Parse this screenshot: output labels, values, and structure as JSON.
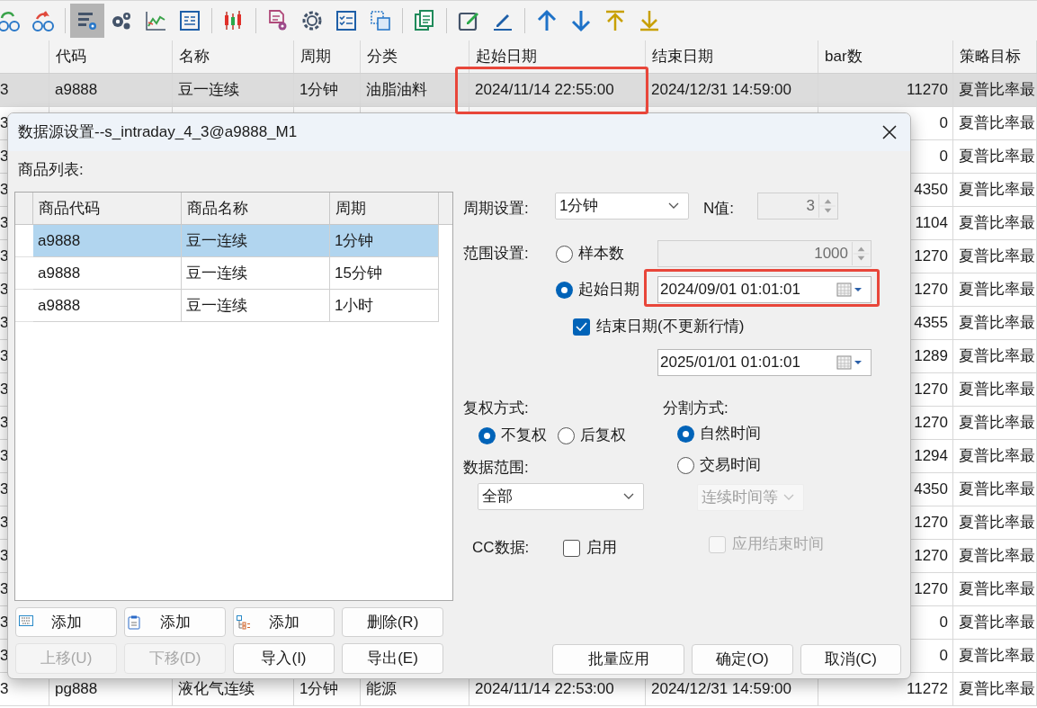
{
  "toolbar": [
    [
      {
        "kind": "glasses-cycle",
        "selected": false
      },
      {
        "kind": "glasses-arrow",
        "selected": false
      }
    ],
    [
      {
        "kind": "list-gear",
        "selected": true
      },
      {
        "kind": "gears",
        "selected": false
      },
      {
        "kind": "line-chart",
        "selected": false
      },
      {
        "kind": "formula",
        "selected": false
      }
    ],
    [
      {
        "kind": "candles",
        "selected": false
      }
    ],
    [
      {
        "kind": "doc-gear",
        "selected": false
      },
      {
        "kind": "gear",
        "selected": false
      },
      {
        "kind": "checklist",
        "selected": false
      },
      {
        "kind": "copy",
        "selected": false
      }
    ],
    [
      {
        "kind": "pages",
        "selected": false
      }
    ],
    [
      {
        "kind": "edit",
        "selected": false
      },
      {
        "kind": "pen",
        "selected": false
      }
    ],
    [
      {
        "kind": "up",
        "selected": false
      },
      {
        "kind": "down",
        "selected": false
      },
      {
        "kind": "top",
        "selected": false
      },
      {
        "kind": "bottom",
        "selected": false
      }
    ]
  ],
  "table": {
    "columns": [
      "代码",
      "名称",
      "周期",
      "分类",
      "起始日期",
      "结束日期",
      "bar数",
      "策略目标"
    ],
    "rows": [
      {
        "column_1": "3",
        "code": "a9888",
        "name": "豆一连续",
        "period": "1分钟",
        "category": "油脂油料",
        "start": "2024/11/14 22:55:00",
        "end": "2024/12/31 14:59:00",
        "bars": "11270",
        "target": "夏普比率最",
        "selected": true
      },
      {
        "column_1": "3",
        "bars": "0",
        "target": "夏普比率最",
        "selected": false
      },
      {
        "column_1": "3",
        "bars": "0",
        "target": "夏普比率最",
        "selected": false
      },
      {
        "column_1": "3",
        "bars": "4350",
        "target": "夏普比率最",
        "selected": false
      },
      {
        "column_1": "3",
        "bars": "1104",
        "target": "夏普比率最",
        "selected": false
      },
      {
        "column_1": "3",
        "bars": "1270",
        "target": "夏普比率最",
        "selected": false
      },
      {
        "column_1": "3",
        "bars": "1270",
        "target": "夏普比率最",
        "selected": false
      },
      {
        "column_1": "3",
        "bars": "4355",
        "target": "夏普比率最",
        "selected": false
      },
      {
        "column_1": "3",
        "bars": "1289",
        "target": "夏普比率最",
        "selected": false
      },
      {
        "column_1": "3",
        "bars": "1270",
        "target": "夏普比率最",
        "selected": false
      },
      {
        "column_1": "3",
        "bars": "1270",
        "target": "夏普比率最",
        "selected": false
      },
      {
        "column_1": "3",
        "bars": "1294",
        "target": "夏普比率最",
        "selected": false
      },
      {
        "column_1": "3",
        "bars": "4350",
        "target": "夏普比率最",
        "selected": false
      },
      {
        "column_1": "3",
        "bars": "1270",
        "target": "夏普比率最",
        "selected": false
      },
      {
        "column_1": "3",
        "bars": "1270",
        "target": "夏普比率最",
        "selected": false
      },
      {
        "column_1": "3",
        "bars": "1270",
        "target": "夏普比率最",
        "selected": false
      },
      {
        "column_1": "3",
        "bars": "0",
        "target": "夏普比率最",
        "selected": false
      },
      {
        "column_1": "3",
        "bars": "0",
        "target": "夏普比率最",
        "selected": false
      },
      {
        "column_1": "3",
        "code": "pg888",
        "name": "液化气连续",
        "period": "1分钟",
        "category": "能源",
        "start": "2024/11/14 22:53:00",
        "end": "2024/12/31 14:59:00",
        "bars": "11272",
        "target": "夏普比率最",
        "selected": false
      }
    ]
  },
  "dialog": {
    "title": "数据源设置--s_intraday_4_3@a9888_M1",
    "list_label": "商品列表:",
    "list": {
      "columns": [
        "商品代码",
        "商品名称",
        "周期"
      ],
      "rows": [
        {
          "code": "a9888",
          "name": "豆一连续",
          "period": "1分钟",
          "selected": true
        },
        {
          "code": "a9888",
          "name": "豆一连续",
          "period": "15分钟",
          "selected": false
        },
        {
          "code": "a9888",
          "name": "豆一连续",
          "period": "1小时",
          "selected": false
        }
      ]
    },
    "list_buttons": [
      {
        "label": "添加",
        "kind": "keyboard",
        "disabled": false
      },
      {
        "label": "添加",
        "kind": "clipboard",
        "disabled": false
      },
      {
        "label": "添加",
        "kind": "tree",
        "disabled": false
      },
      {
        "label": "删除(R)",
        "kind": "plain",
        "disabled": false
      },
      {
        "label": "上移(U)",
        "kind": "plain",
        "disabled": true
      },
      {
        "label": "下移(D)",
        "kind": "plain",
        "disabled": true
      },
      {
        "label": "导入(I)",
        "kind": "plain",
        "disabled": false
      },
      {
        "label": "导出(E)",
        "kind": "plain",
        "disabled": false
      }
    ],
    "period": {
      "label": "周期设置:",
      "value": "1分钟",
      "n_label": "N值:",
      "n_value": "3",
      "n_disabled": true
    },
    "range": {
      "label": "范围设置:",
      "options": [
        {
          "label": "样本数",
          "selected": false,
          "value": "1000",
          "disabled": true
        },
        {
          "label": "起始日期",
          "selected": true,
          "value": "2024/09/01 01:01:01",
          "disabled": false
        }
      ],
      "end": {
        "label": "结束日期(不更新行情)",
        "checked": true,
        "value": "2025/01/01 01:01:01"
      }
    },
    "adjust": {
      "label": "复权方式:",
      "options": [
        {
          "label": "不复权",
          "selected": true
        },
        {
          "label": "后复权",
          "selected": false
        }
      ]
    },
    "data_range": {
      "label": "数据范围:",
      "value": "全部"
    },
    "split": {
      "label": "分割方式:",
      "options": [
        {
          "label": "自然时间",
          "selected": true
        },
        {
          "label": "交易时间",
          "selected": false
        }
      ],
      "mode": {
        "value": "连续时间等",
        "disabled": true
      }
    },
    "cc": {
      "label": "CC数据:",
      "option": {
        "label": "启用",
        "checked": false
      }
    },
    "apply_end": {
      "label": "应用结束时间",
      "checked": false,
      "disabled": true
    },
    "buttons": [
      {
        "label": "批量应用"
      },
      {
        "label": "确定(O)"
      },
      {
        "label": "取消(C)"
      }
    ]
  }
}
